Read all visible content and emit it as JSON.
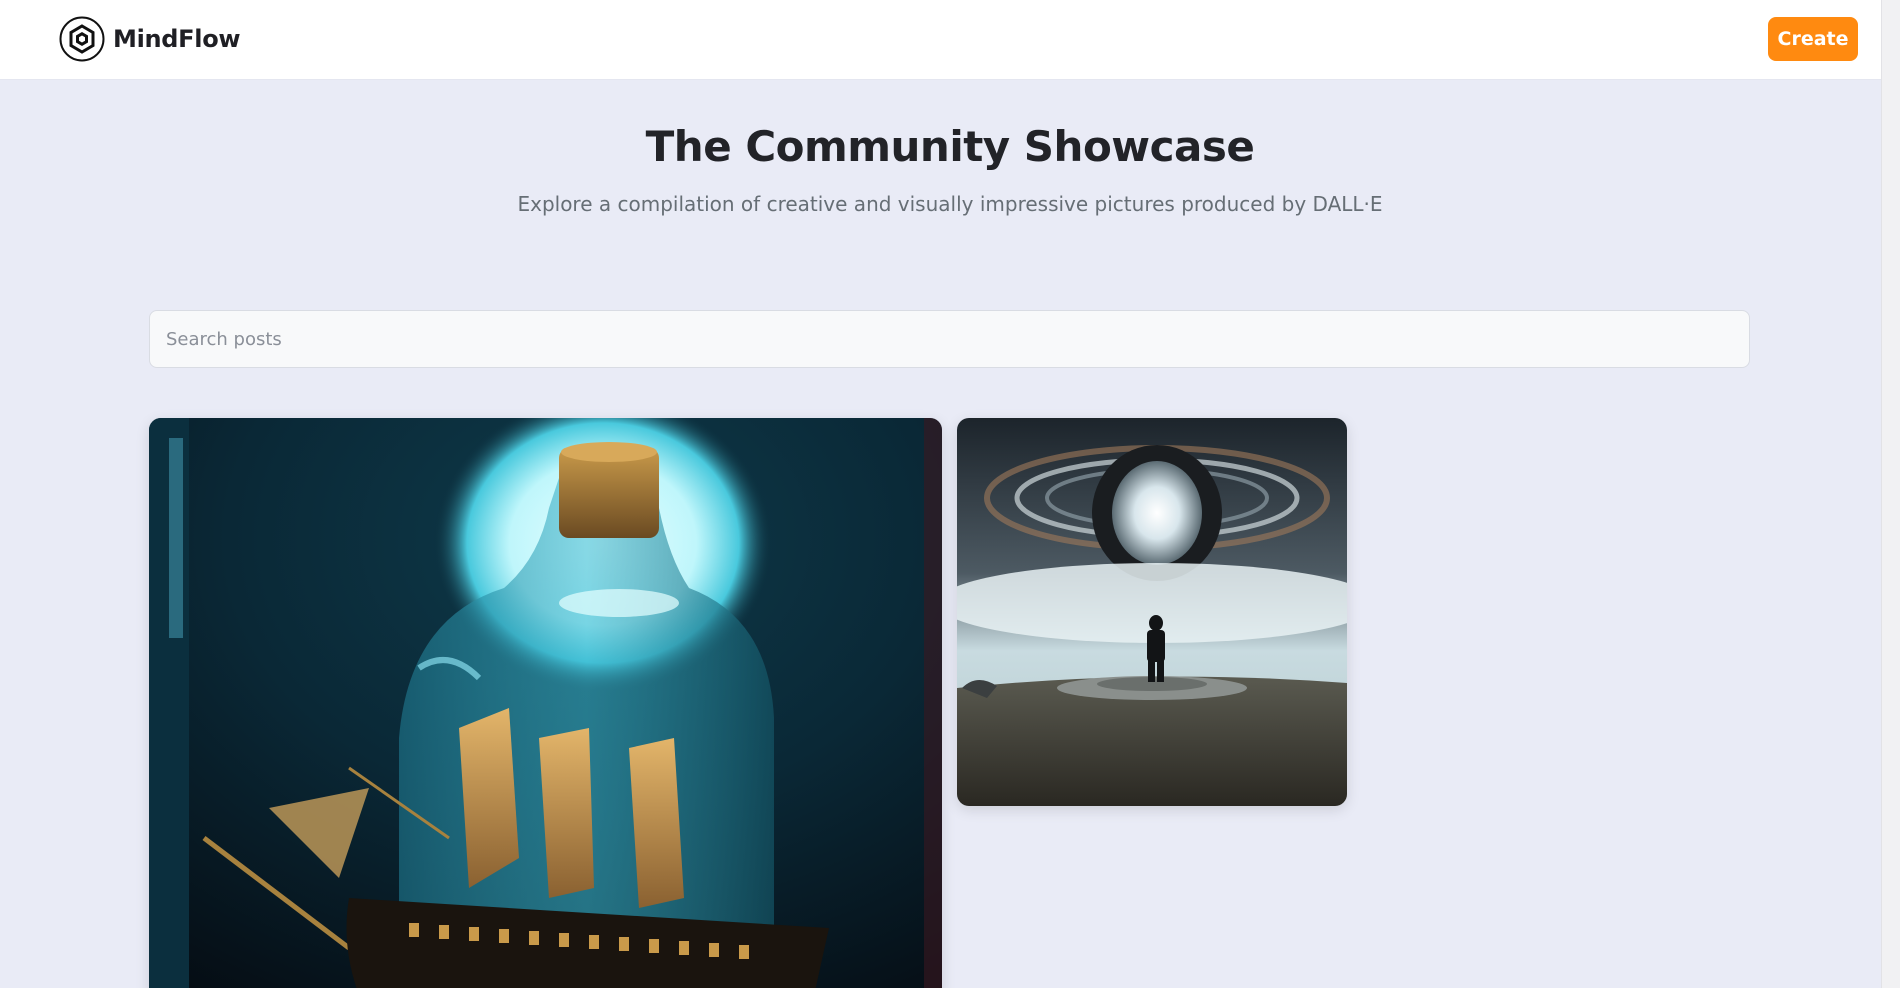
{
  "app": {
    "brand_name": "MindFlow",
    "logo_icon": "mindflow-logo-icon"
  },
  "header": {
    "create_label": "Create"
  },
  "hero": {
    "title": "The Community Showcase",
    "subtitle": "Explore a compilation of creative and visually impressive pictures produced by DALL·E"
  },
  "search": {
    "placeholder": "Search posts",
    "value": ""
  },
  "gallery": {
    "posts": [
      {
        "subject": "ship-in-a-bottle"
      },
      {
        "subject": "figure-before-portal"
      }
    ]
  },
  "colors": {
    "accent": "#ff8a10",
    "background": "#e9ebf6",
    "header_bg": "#ffffff",
    "title_text": "#222328",
    "subtitle_text": "#666e75"
  }
}
